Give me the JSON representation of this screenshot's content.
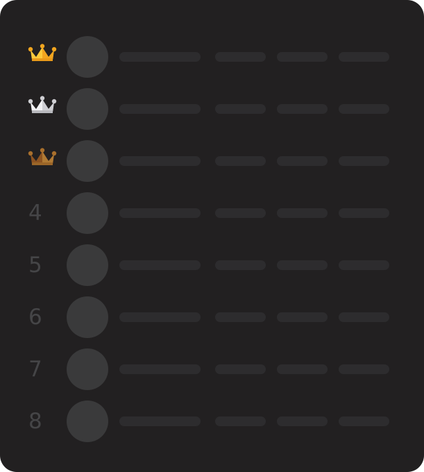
{
  "leaderboard": {
    "rows": [
      {
        "rank": "",
        "badge": "gold-crown"
      },
      {
        "rank": "",
        "badge": "silver-crown"
      },
      {
        "rank": "",
        "badge": "bronze-crown"
      },
      {
        "rank": "4",
        "badge": ""
      },
      {
        "rank": "5",
        "badge": ""
      },
      {
        "rank": "6",
        "badge": ""
      },
      {
        "rank": "7",
        "badge": ""
      },
      {
        "rank": "8",
        "badge": ""
      }
    ]
  },
  "colors": {
    "background": "#222021",
    "skeleton_avatar": "#3a3a3b",
    "skeleton_bar": "#2d2c2e",
    "rank_text": "#454547",
    "gold": "#f6b52e",
    "silver": "#d9d9dc",
    "bronze": "#a0692b"
  }
}
